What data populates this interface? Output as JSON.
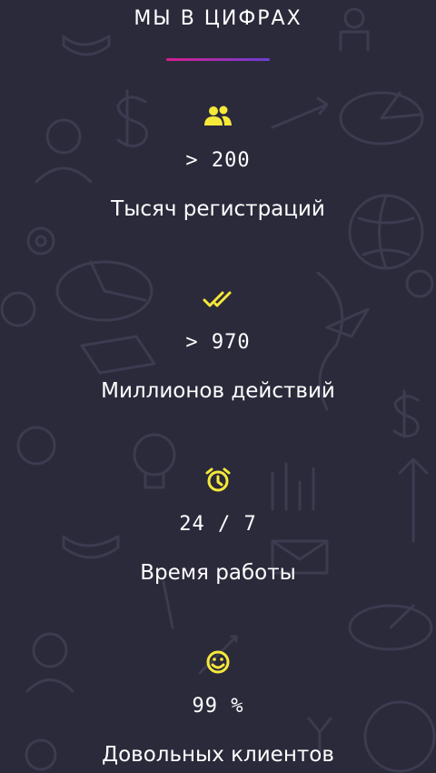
{
  "section": {
    "title": "МЫ В ЦИФРАХ",
    "accent_gradient": [
      "#d91d8e",
      "#6a3fd1"
    ],
    "icon_color": "#f6e93a",
    "background_color": "#2b2a3b"
  },
  "stats": [
    {
      "icon": "people-icon",
      "value": "> 200",
      "label": "Тысяч регистраций"
    },
    {
      "icon": "double-check-icon",
      "value": "> 970",
      "label": "Миллионов действий"
    },
    {
      "icon": "alarm-clock-icon",
      "value": "24 / 7",
      "label": "Время работы"
    },
    {
      "icon": "smiley-face-icon",
      "value": "99 %",
      "label": "Довольных клиентов"
    }
  ]
}
